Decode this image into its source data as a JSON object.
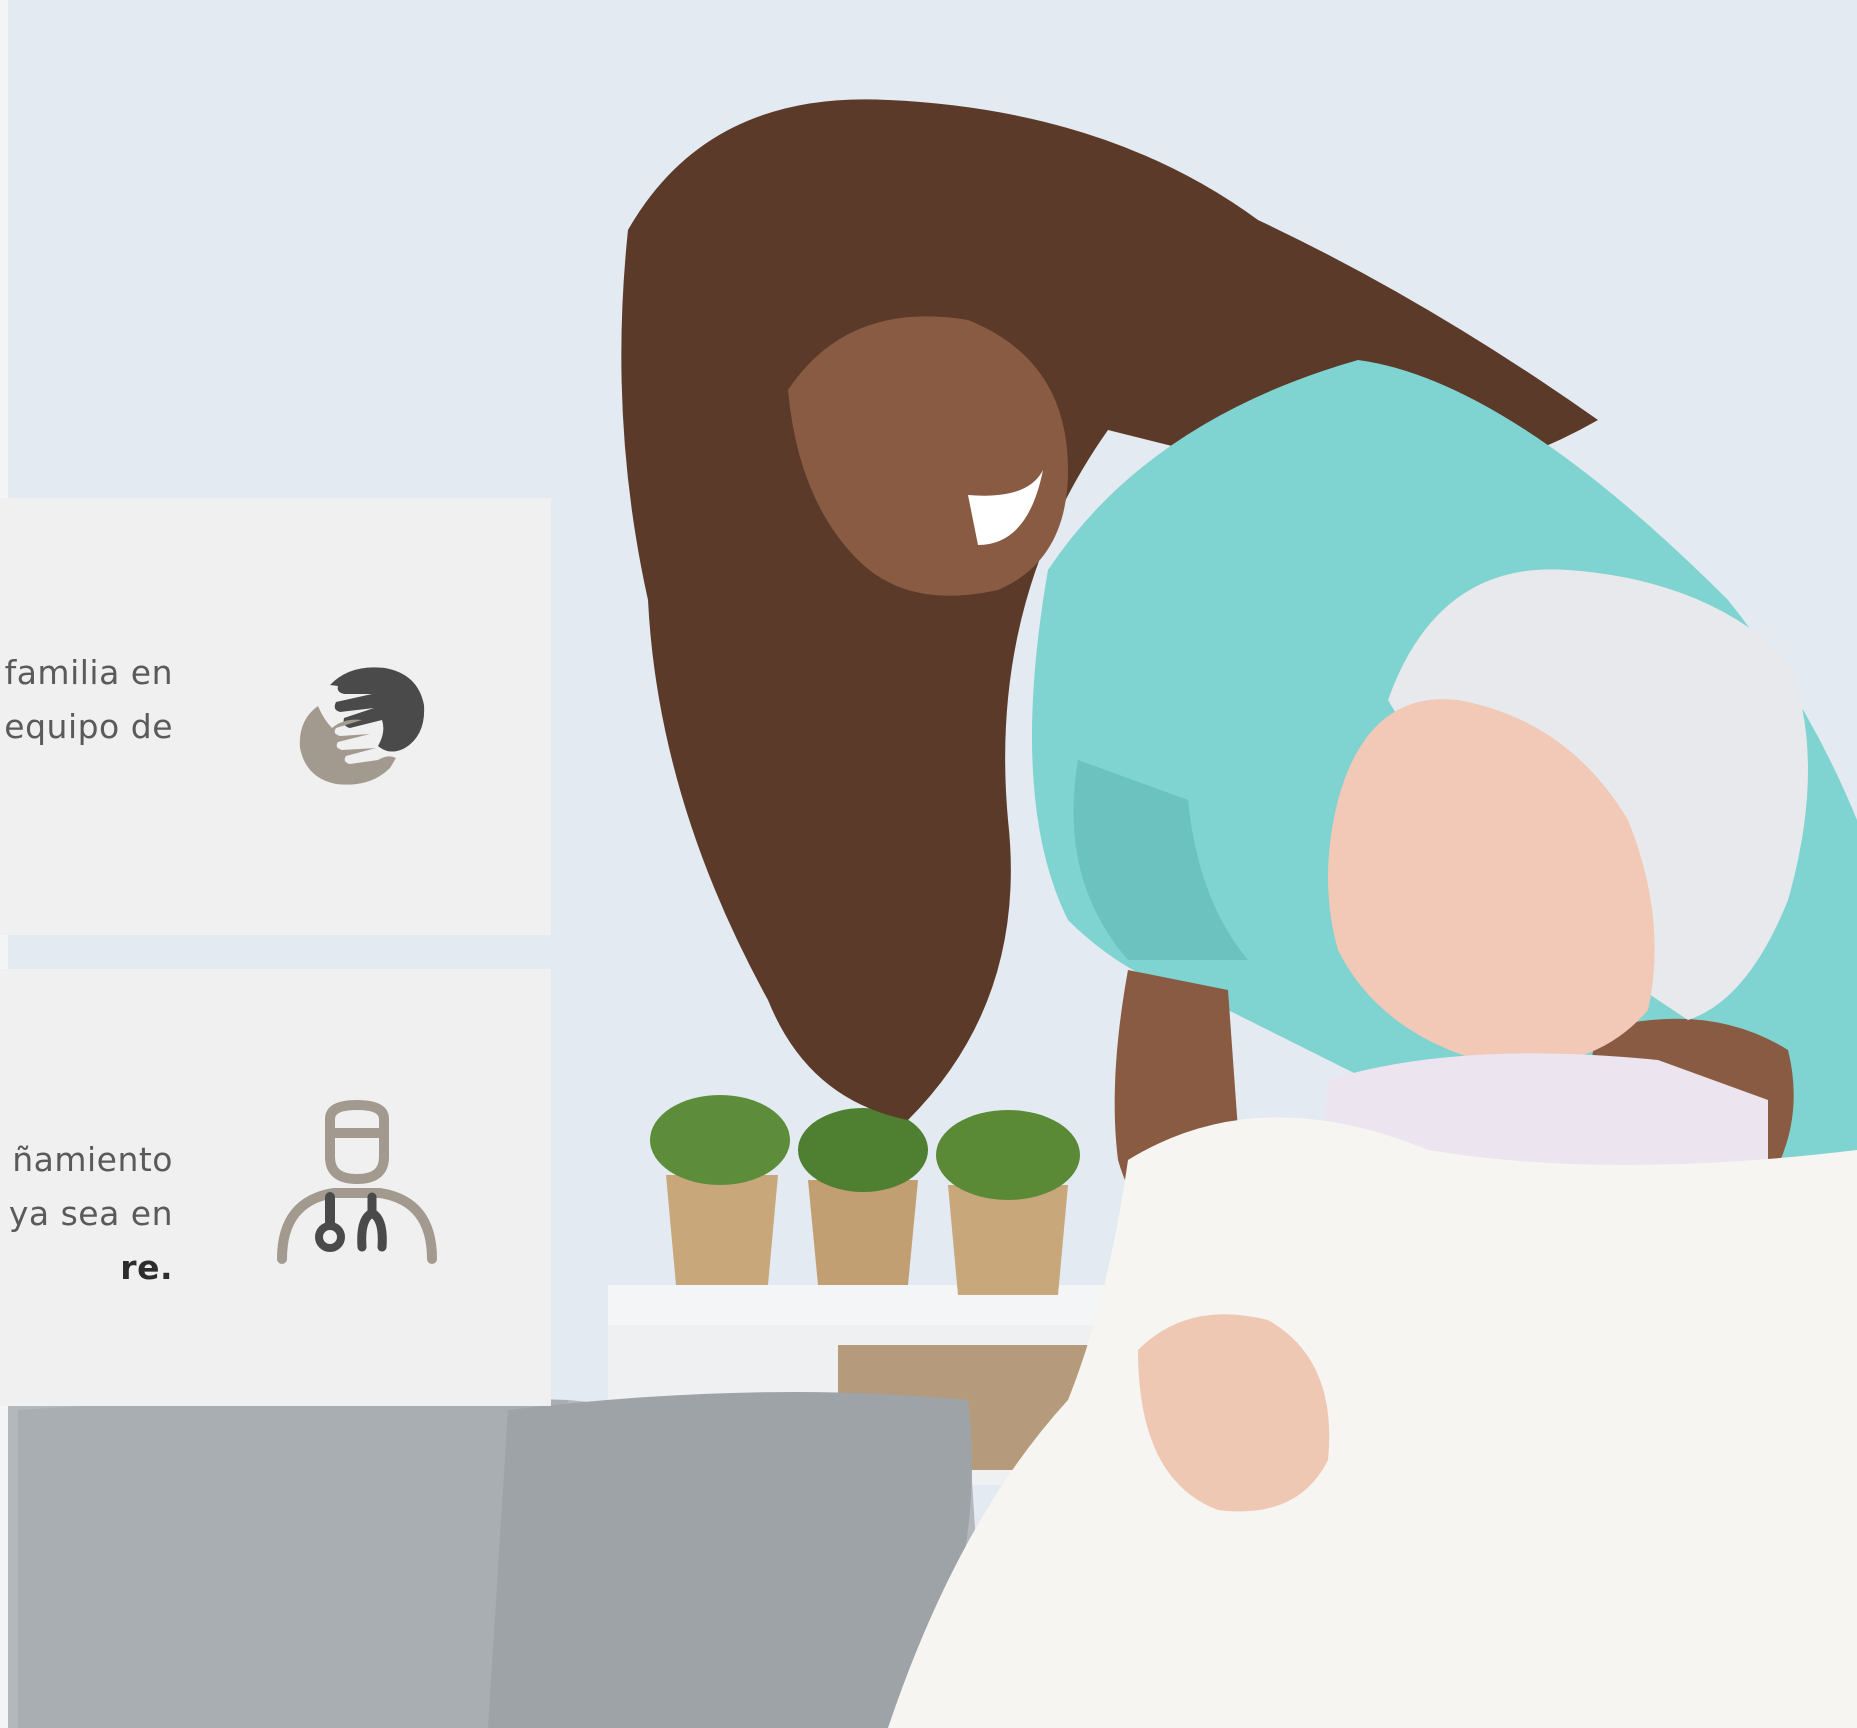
{
  "cards": [
    {
      "lines": [
        "familia en",
        "equipo de"
      ],
      "bold_line": "",
      "icon": "hands-care-icon",
      "icon_colors": {
        "primary": "#4a4a4a",
        "secondary": "#a39a8f"
      }
    },
    {
      "lines": [
        "ñamiento",
        "ya sea en"
      ],
      "bold_line": "re.",
      "icon": "doctor-stethoscope-icon",
      "icon_colors": {
        "primary": "#a39a8f",
        "secondary": "#4a4a4a"
      }
    }
  ],
  "colors": {
    "card_background": "#f0f0f0",
    "text": "#5a5a5a",
    "bold_text": "#2c2c2c",
    "scrub_teal": "#7fd3d0"
  }
}
